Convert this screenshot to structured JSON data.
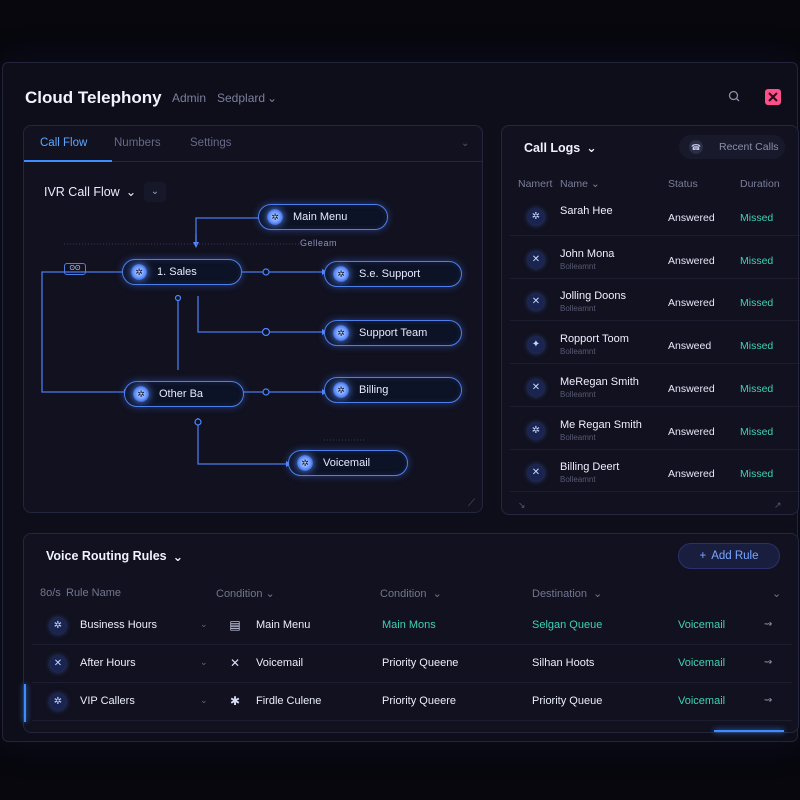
{
  "header": {
    "title": "Cloud Telephony",
    "admin": "Admin",
    "dashboard": "Sedplard",
    "dashboard_chevron": "⌄",
    "search_icon": "search-icon",
    "close_icon": "close-icon",
    "accent": "#ff4f8b"
  },
  "flow": {
    "tabs": [
      {
        "label": "Call Flow",
        "active": true
      },
      {
        "label": "Numbers",
        "active": false
      },
      {
        "label": "Settings",
        "active": false
      }
    ],
    "title": "IVR Call Flow",
    "title_chevron": "⌄",
    "badge": "ʘʘ",
    "caption_main": "Gelleam",
    "nodes": {
      "main_menu": "Main Menu",
      "sales": "1. Sales",
      "support": "S.e. Support",
      "support_team": "Support Team",
      "other": "Other Ba",
      "billing": "Billing",
      "voicemail": "Voicemail"
    }
  },
  "logs": {
    "title": "Call Logs",
    "title_chevron": "⌄",
    "recent_button": "Recent Calls",
    "columns": {
      "c1": "Namert",
      "c2": "Name",
      "c3": "Status",
      "c4": "Duration"
    },
    "rows": [
      {
        "name": "Sarah Hee",
        "sub": "",
        "status": "Answered",
        "duration": "Missed"
      },
      {
        "name": "John Mona",
        "sub": "Bolleamnt",
        "status": "Answered",
        "duration": "Missed"
      },
      {
        "name": "Jolling Doons",
        "sub": "Bolleamnt",
        "status": "Answered",
        "duration": "Missed"
      },
      {
        "name": "Ropport Toom",
        "sub": "Bolleamnt",
        "status": "Answeed",
        "duration": "Missed"
      },
      {
        "name": "MeRegan Smith",
        "sub": "Bolleamnt",
        "status": "Answered",
        "duration": "Missed"
      },
      {
        "name": "Me Regan Smith",
        "sub": "Bolleamnt",
        "status": "Answered",
        "duration": "Missed"
      },
      {
        "name": "Billing Deert",
        "sub": "Bolleamnt",
        "status": "Answered",
        "duration": "Missed"
      }
    ]
  },
  "routing": {
    "title": "Voice Routing Rules",
    "title_chevron": "⌄",
    "add_button": "Add Rule",
    "columns": {
      "c0": "8o/s",
      "c1": "Rule Name",
      "c2": "Condition",
      "c3": "Condition",
      "c4": "Destination"
    },
    "rows": [
      {
        "rule": "Business Hours",
        "condition": "Main Menu",
        "condition2": "Main Mons",
        "destination": "Selgan Queue",
        "target": "Voicemail",
        "teal": true
      },
      {
        "rule": "After Hours",
        "condition": "Voicemail",
        "condition2": "Priority Queene",
        "destination": "Silhan Hoots",
        "target": "Voicemail",
        "teal": false
      },
      {
        "rule": "VIP Callers",
        "condition": "Firdle Culene",
        "condition2": "Priority Queere",
        "destination": "Priority Queue",
        "target": "Voicemail",
        "teal": false
      }
    ]
  }
}
